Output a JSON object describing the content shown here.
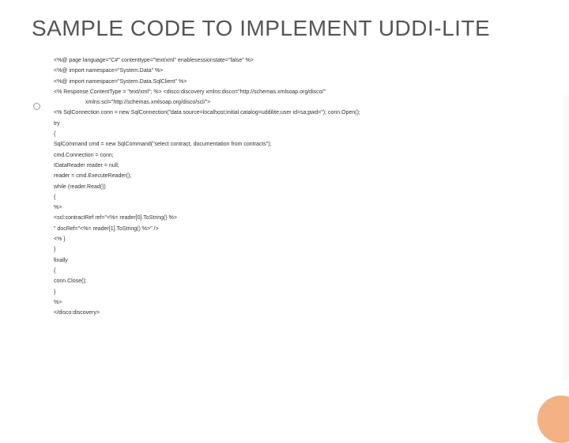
{
  "title": "SAMPLE CODE TO IMPLEMENT UDDI-LITE",
  "code": [
    "<%@ page language=\"C#\" contenttype=\"text/xml\" enablesessionstate=\"false\" %>",
    "<%@ import namespace=\"System.Data\" %>",
    "<%@ import namespace=\"System.Data.SqlClient\" %>",
    "<% Response.ContentType = \"text/xml\"; %> <disco:discovery xmlns:disco=\"http://schemas.xmlsoap.org/disco/\"",
    "xmlns:scl=\"http://schemas.xmlsoap.org/disco/scl/\">",
    "<% SqlConnection conn = new SqlConnection(\"data source=localhost;initial catalog=uddilite;user id=sa;pwd=\"); conn.Open();",
    "try",
    "{",
    "SqlCommand cmd = new SqlCommand(\"select contract, documentation from contracts\");",
    "cmd.Connection = conn;",
    "IDataReader reader = null;",
    "reader = cmd.ExecuteReader();",
    "while (reader.Read())",
    "{",
    "%>",
    "<scl:contractRef ref=\"<%= reader[0].ToString() %>",
    "\" docRef=\"<%= reader[1].ToString() %>\" />",
    "<% }",
    "}",
    "finally",
    "{",
    "conn.Close();",
    "}",
    "%>",
    "</disco:discovery>"
  ],
  "indent_line_index": 4
}
